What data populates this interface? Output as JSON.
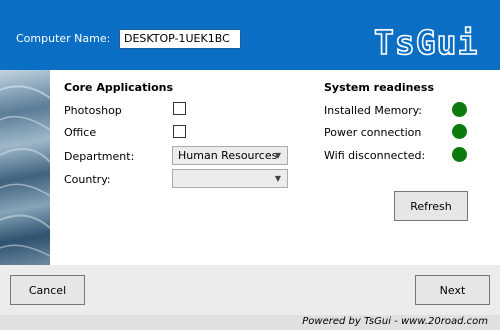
{
  "header": {
    "computer_name_label": "Computer Name:",
    "computer_name_value": "DESKTOP-1UEK1BC",
    "logo_text": "TsGui"
  },
  "core_apps": {
    "title": "Core Applications",
    "photoshop_label": "Photoshop",
    "photoshop_checked": false,
    "office_label": "Office",
    "office_checked": false,
    "department_label": "Department:",
    "department_value": "Human Resources",
    "country_label": "Country:",
    "country_value": ""
  },
  "readiness": {
    "title": "System readiness",
    "items": [
      {
        "label": "Installed Memory:",
        "status_color": "#0c7a0c"
      },
      {
        "label": "Power connection",
        "status_color": "#0c7a0c"
      },
      {
        "label": "Wifi disconnected:",
        "status_color": "#0c7a0c"
      }
    ],
    "refresh_label": "Refresh"
  },
  "footer": {
    "cancel_label": "Cancel",
    "next_label": "Next",
    "powered_text": "Powered by TsGui - www.20road.com"
  },
  "colors": {
    "header_bg": "#0a6fc4",
    "status_ok": "#0c7a0c"
  }
}
